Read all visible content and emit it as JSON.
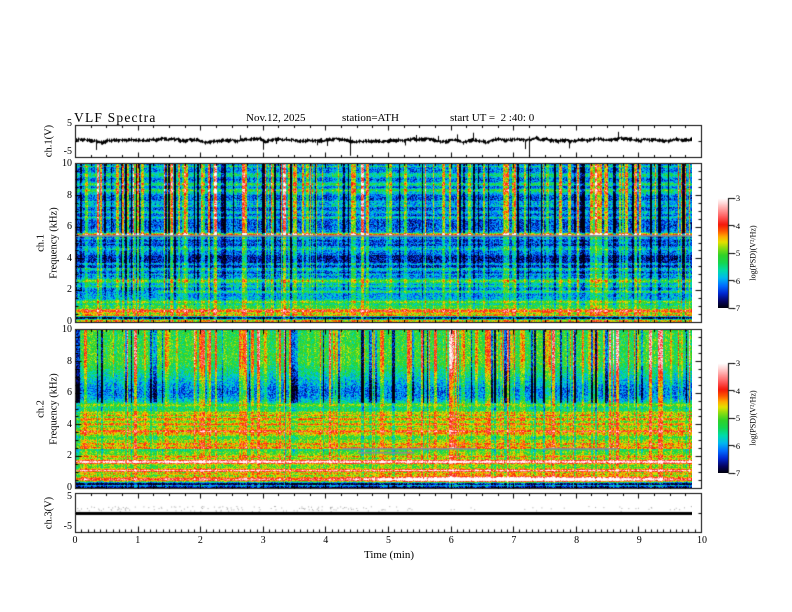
{
  "header": {
    "title": "VLF Spectra",
    "date": "Nov.12, 2025",
    "station": "station=ATH",
    "start_ut": "start UT =  2 :40: 0"
  },
  "axes": {
    "time": {
      "label": "Time  (min)",
      "ticks": [
        "0",
        "1",
        "2",
        "3",
        "4",
        "5",
        "6",
        "7",
        "8",
        "9",
        "10"
      ],
      "range": [
        0,
        10
      ]
    },
    "ch1_wave": {
      "label": "ch.1(V)",
      "ticks": [
        "5",
        "-5"
      ],
      "range": [
        -5,
        5
      ]
    },
    "ch1_spec": {
      "label_channel": "ch.1",
      "label_axis": "Frequency  (kHz)",
      "ticks": [
        "10",
        "8",
        "6",
        "4",
        "2",
        "0"
      ],
      "range": [
        0,
        10
      ]
    },
    "ch2_spec": {
      "label_channel": "ch.2",
      "label_axis": "Frequency  (kHz)",
      "ticks": [
        "10",
        "8",
        "6",
        "4",
        "2",
        "0"
      ],
      "range": [
        0,
        10
      ]
    },
    "ch3_wave": {
      "label": "ch.3(V)",
      "ticks": [
        "5",
        "-5"
      ],
      "range": [
        -5,
        5
      ]
    }
  },
  "colorbar": {
    "label": "log(PSD)(V²/Hz)",
    "ticks": [
      "-3",
      "-4",
      "-5",
      "-6",
      "-7"
    ],
    "range": [
      -3,
      -7
    ]
  },
  "palette": [
    [
      0.0,
      0,
      0,
      16
    ],
    [
      0.06,
      5,
      5,
      100
    ],
    [
      0.13,
      0,
      40,
      210
    ],
    [
      0.2,
      0,
      110,
      255
    ],
    [
      0.27,
      0,
      185,
      240
    ],
    [
      0.34,
      0,
      220,
      170
    ],
    [
      0.41,
      20,
      215,
      80
    ],
    [
      0.48,
      50,
      210,
      40
    ],
    [
      0.54,
      130,
      220,
      20
    ],
    [
      0.6,
      230,
      225,
      0
    ],
    [
      0.65,
      255,
      170,
      0
    ],
    [
      0.7,
      255,
      90,
      0
    ],
    [
      0.76,
      245,
      25,
      10
    ],
    [
      0.83,
      255,
      90,
      90
    ],
    [
      0.9,
      255,
      160,
      160
    ],
    [
      0.96,
      255,
      220,
      220
    ],
    [
      1.0,
      255,
      255,
      255
    ]
  ],
  "chart_data": [
    {
      "type": "line",
      "name": "ch1_waveform",
      "panel": "ch.1(V)",
      "ylim": [
        -5,
        5
      ],
      "time_range_min": [
        0,
        9.83
      ],
      "seed": 11121,
      "mean_level": 0.4,
      "noise_band": 0.5,
      "spike_down_rate": 0.013,
      "spike_up_rate": 0.008,
      "dropout_rate": 0.005,
      "description": "noisy signal fluctuating around +0.4 V with frequent narrow downward spikes reaching about -4 V"
    },
    {
      "type": "heatmap",
      "name": "ch1_spectrogram",
      "panel": "ch.1 Frequency (kHz)",
      "f_max": 10,
      "t_end": 9.83,
      "vlim": [
        -7,
        -3
      ],
      "seed": 1112,
      "profile": [
        [
          10,
          -6.1
        ],
        [
          8,
          -6.3
        ],
        [
          6,
          -6.3
        ],
        [
          5.6,
          -5.9
        ],
        [
          5.4,
          -6.55
        ],
        [
          4,
          -6.6
        ],
        [
          3.2,
          -6.5
        ],
        [
          2.7,
          -5.9
        ],
        [
          2,
          -6.15
        ],
        [
          1.5,
          -5.9
        ],
        [
          1.1,
          -5.7
        ],
        [
          0.8,
          -5.1
        ],
        [
          0.6,
          -5.3
        ],
        [
          0.45,
          -4.1
        ],
        [
          0.3,
          -6.3
        ],
        [
          0.15,
          -5.4
        ],
        [
          0,
          -6.2
        ]
      ],
      "stripe_zones": [
        {
          "f0": 5.5,
          "f1": 10,
          "w": 1
        },
        {
          "f0": 2,
          "f1": 5.5,
          "w": 0.5
        },
        {
          "f0": 0,
          "f1": 2,
          "w": 0.32
        }
      ],
      "stripes": {
        "dark_p": 0.13,
        "dark_dv": -1.3,
        "bright_p": 0.22,
        "bright_dv": 1.35,
        "vivid_p": 0.045,
        "vivid_dv": 2.1
      },
      "hlines": [
        {
          "f": 5.58,
          "dv": 1.5,
          "hw": 0.05
        },
        {
          "f": 4.78,
          "dv": 0.6,
          "hw": 0.05
        },
        {
          "f": 3.05,
          "dv": 0.55,
          "hw": 0.04
        },
        {
          "f": 2.62,
          "dv": 0.95,
          "hw": 0.09
        },
        {
          "f": 2.3,
          "dv": 0.6,
          "hw": 0.05
        },
        {
          "f": 1.95,
          "dv": 0.85,
          "hw": 0.06,
          "t0": 1.3,
          "t1": 9.83
        },
        {
          "f": 1.3,
          "dv": 0.9,
          "hw": 0.07
        },
        {
          "f": 1.05,
          "dv": 0.5,
          "hw": 0.05
        },
        {
          "f": 0.72,
          "dv": 1.3,
          "hw": 0.09
        },
        {
          "f": 0.3,
          "dv": -0.8,
          "hw": 0.08
        },
        {
          "f": 0.12,
          "dv": 0.9,
          "hw": 0.06
        },
        {
          "f": 0.05,
          "dv": 0.8,
          "hw": 0.05
        }
      ],
      "random_hlines": {
        "count": 26,
        "f0": 2.9,
        "f1": 9.9,
        "dv": 0.55
      },
      "events": [],
      "gray_segments": [
        {
          "f": 5.52,
          "t0": 0,
          "t1": 9.83
        }
      ]
    },
    {
      "type": "heatmap",
      "name": "ch2_spectrogram",
      "panel": "ch.2 Frequency (kHz)",
      "f_max": 10,
      "t_end": 9.83,
      "vlim": [
        -7,
        -3
      ],
      "seed": 2512,
      "profile": [
        [
          10,
          -5.2
        ],
        [
          8,
          -5.15
        ],
        [
          7.2,
          -5.6
        ],
        [
          6.2,
          -6.2
        ],
        [
          5.8,
          -6.1
        ],
        [
          5.3,
          -5.5
        ],
        [
          4.8,
          -5.3
        ],
        [
          4,
          -5.15
        ],
        [
          3,
          -5.2
        ],
        [
          2.2,
          -5.05
        ],
        [
          1.6,
          -5
        ],
        [
          1.2,
          -4.95
        ],
        [
          0.8,
          -5.05
        ],
        [
          0.55,
          -4.5
        ],
        [
          0.35,
          -5.8
        ],
        [
          0.2,
          -6.6
        ],
        [
          0,
          -6.2
        ]
      ],
      "stripe_zones": [
        {
          "f0": 7.4,
          "f1": 10,
          "w": 1
        },
        {
          "f0": 5.4,
          "f1": 7.4,
          "w": 0.9
        },
        {
          "f0": 1.8,
          "f1": 5.4,
          "w": 0.42
        },
        {
          "f0": 0,
          "f1": 1.8,
          "w": 0.3
        }
      ],
      "stripes": {
        "dark_p": 0.15,
        "dark_dv": -1.25,
        "bright_p": 0.2,
        "bright_dv": 1.0,
        "vivid_p": 0.06,
        "vivid_dv": 1.7
      },
      "hlines": [
        {
          "f": 4.35,
          "dv": 0.8,
          "hw": 0.06
        },
        {
          "f": 3.62,
          "dv": 0.6,
          "hw": 0.05
        },
        {
          "f": 2.82,
          "dv": 0.9,
          "hw": 0.06
        },
        {
          "f": 2.48,
          "dv": -0.9,
          "hw": 0.05
        },
        {
          "f": 2.02,
          "dv": 0.7,
          "hw": 0.05
        },
        {
          "f": 1.65,
          "dv": 1.0,
          "hw": 0.07
        },
        {
          "f": 1.15,
          "dv": 0.8,
          "hw": 0.06
        },
        {
          "f": 0.92,
          "dv": 0.6,
          "hw": 0.05
        },
        {
          "f": 0.58,
          "dv": 0.9,
          "hw": 0.1
        },
        {
          "f": 0.3,
          "dv": -1.0,
          "hw": 0.07
        },
        {
          "f": 0.18,
          "dv": 0.9,
          "hw": 0.04
        },
        {
          "f": 0.07,
          "dv": -0.6,
          "hw": 0.05
        }
      ],
      "random_hlines": {
        "count": 22,
        "f0": 0.8,
        "f1": 5.4,
        "dv": 0.5
      },
      "events": [
        {
          "f": 0.58,
          "hw": 0.16,
          "t0": 4.2,
          "t1": 9.55,
          "peak": 6.6,
          "dv": 1.5
        }
      ],
      "gray_segments": [
        {
          "f": 2.52,
          "t0": 4.25,
          "t1": 6.4
        },
        {
          "f": 2.55,
          "t0": 7.45,
          "t1": 8.65
        },
        {
          "f": 2.3,
          "t0": 4.5,
          "t1": 5.4
        }
      ]
    },
    {
      "type": "line",
      "name": "ch3_waveform",
      "panel": "ch.3(V)",
      "ylim": [
        -5,
        5
      ],
      "time_range_min": [
        0,
        9.83
      ],
      "constant_level": 0.15,
      "line_thickness_px": 3,
      "description": "flat constant trace near 0 V for the entire interval"
    }
  ]
}
